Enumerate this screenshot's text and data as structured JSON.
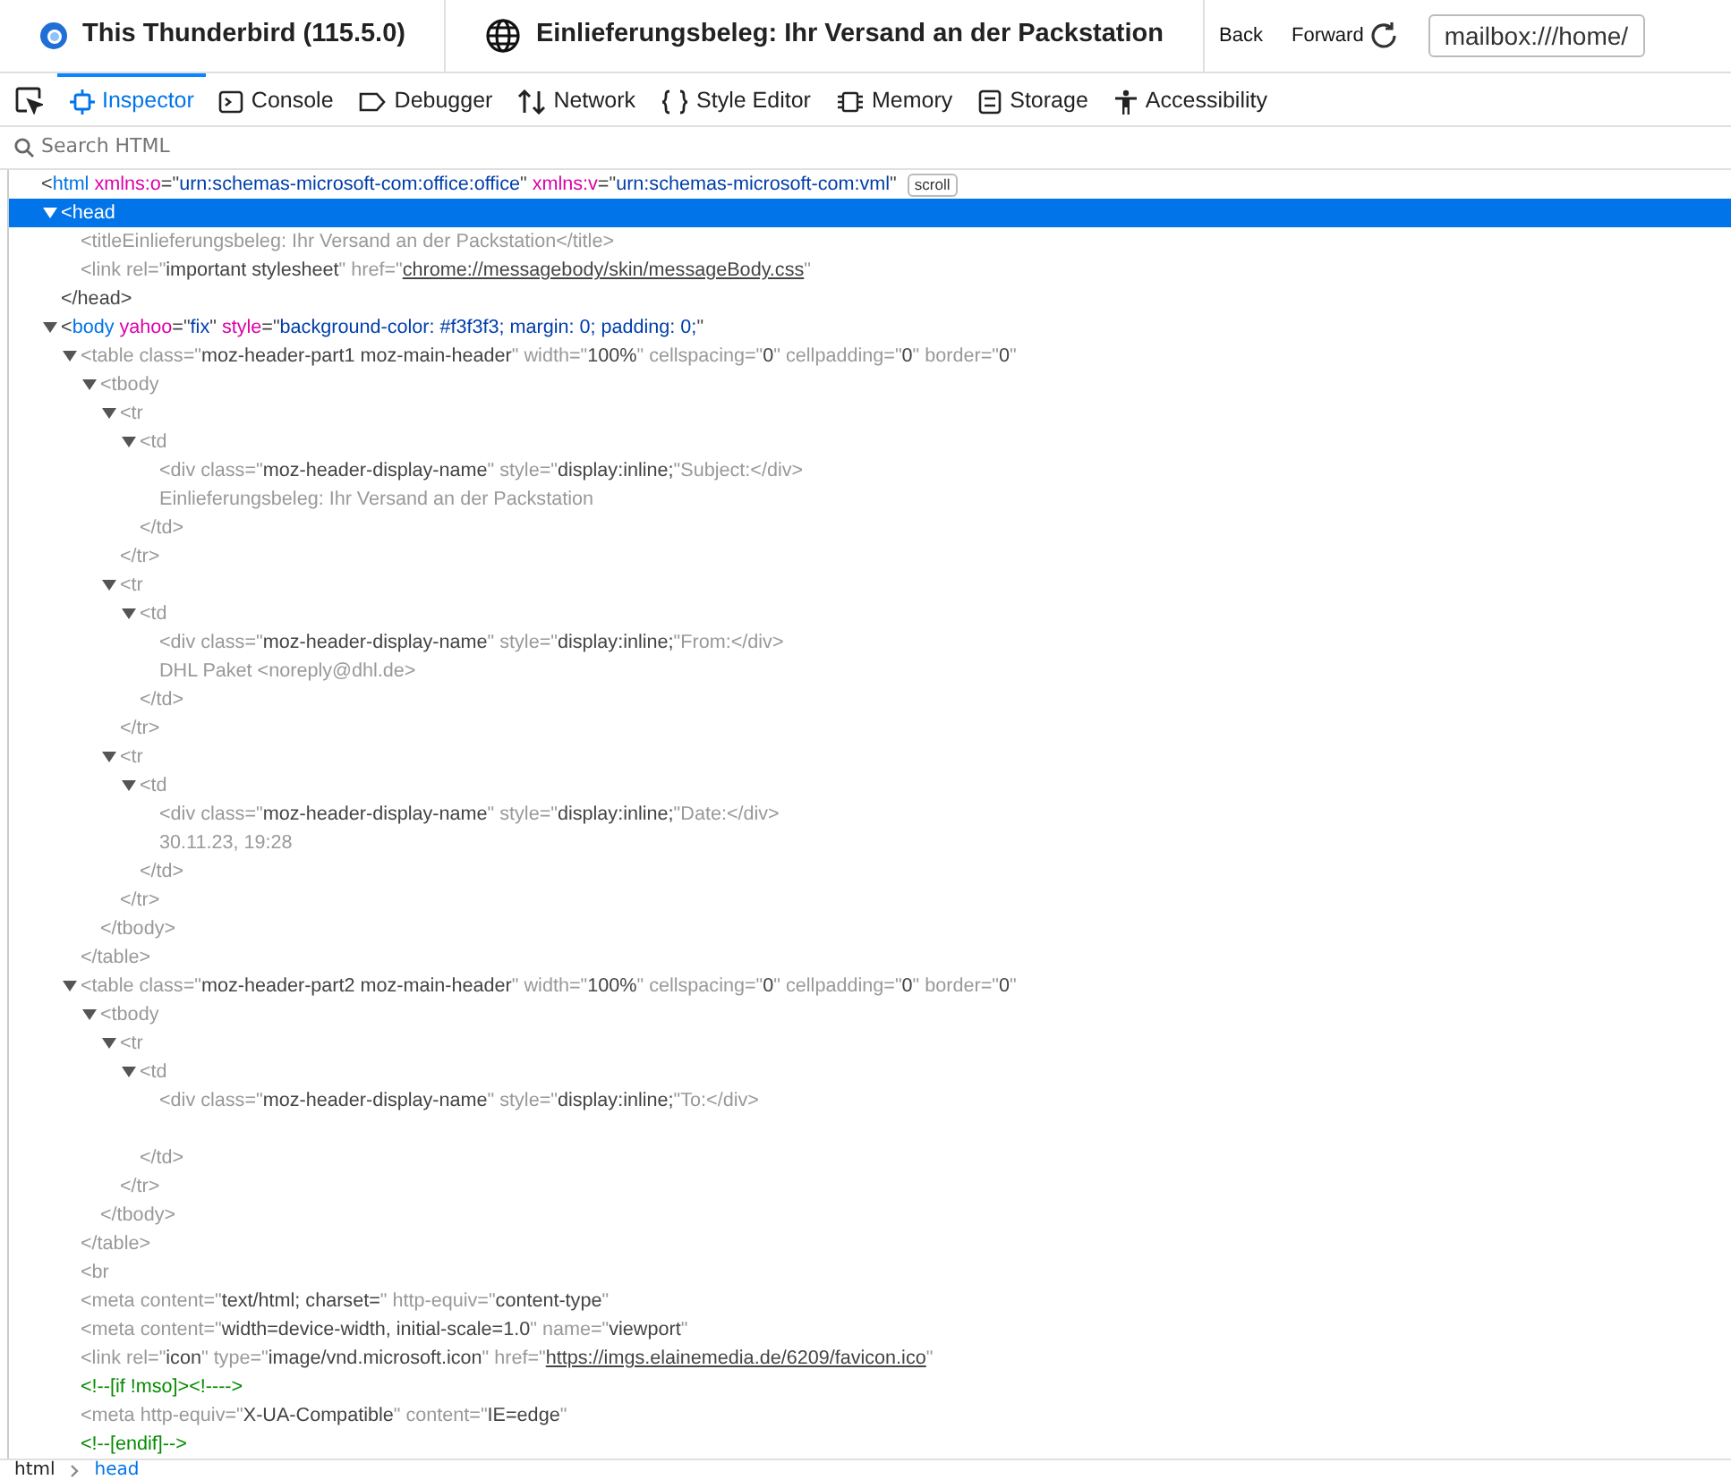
{
  "browser_tabs": [
    {
      "title": "This Thunderbird (115.5.0)"
    },
    {
      "title": "Einlieferungsbeleg: Ihr Versand an der Packstation"
    }
  ],
  "nav": {
    "back": "Back",
    "forward": "Forward",
    "url": "mailbox:///home/"
  },
  "devtools_tabs": [
    {
      "label": "Inspector",
      "selected": true
    },
    {
      "label": "Console",
      "selected": false
    },
    {
      "label": "Debugger",
      "selected": false
    },
    {
      "label": "Network",
      "selected": false
    },
    {
      "label": "Style Editor",
      "selected": false
    },
    {
      "label": "Memory",
      "selected": false
    },
    {
      "label": "Storage",
      "selected": false
    },
    {
      "label": "Accessibility",
      "selected": false
    }
  ],
  "search": {
    "placeholder": "Search HTML"
  },
  "markup": [
    {
      "dimmed": false,
      "selected": false,
      "badge": "scroll",
      "open": [
        {
          "kind": "p",
          "text": "<"
        },
        {
          "kind": "tag",
          "text": "html"
        },
        {
          "kind": "attr",
          "text": " xmlns:o"
        },
        {
          "kind": "p",
          "text": "=\""
        },
        {
          "kind": "value",
          "text": "urn:schemas-microsoft-com:office:office"
        },
        {
          "kind": "p",
          "text": "\" "
        },
        {
          "kind": "attr",
          "text": "xmlns:v"
        },
        {
          "kind": "p",
          "text": "=\""
        },
        {
          "kind": "value",
          "text": "urn:schemas-microsoft-com:vml"
        },
        {
          "kind": "p",
          "text": "\""
        }
      ],
      "children": [
        {
          "dimmed": false,
          "selected": true,
          "expanded": true,
          "open": [
            {
              "kind": "p",
              "text": "<"
            },
            {
              "kind": "tag",
              "text": "head"
            }
          ],
          "close": [
            {
              "kind": "p",
              "text": "</head>"
            }
          ],
          "children": [
            {
              "dimmed": true,
              "selected": false,
              "open": [
                {
                  "kind": "p",
                  "text": "<title"
                },
                {
                  "kind": "text",
                  "text": "Einlieferungsbeleg: Ihr Versand an der Packstation"
                },
                {
                  "kind": "p",
                  "text": "</title>"
                }
              ]
            },
            {
              "dimmed": true,
              "selected": false,
              "open": [
                {
                  "kind": "p",
                  "text": "<link "
                },
                {
                  "kind": "attr",
                  "text": "rel"
                },
                {
                  "kind": "p",
                  "text": "=\""
                },
                {
                  "kind": "value",
                  "text": "important stylesheet"
                },
                {
                  "kind": "p",
                  "text": "\" "
                },
                {
                  "kind": "attr",
                  "text": "href"
                },
                {
                  "kind": "p",
                  "text": "=\""
                },
                {
                  "kind": "link",
                  "text": "chrome://messagebody/skin/messageBody.css"
                },
                {
                  "kind": "p",
                  "text": "\""
                }
              ]
            }
          ]
        },
        {
          "dimmed": false,
          "selected": false,
          "expanded": true,
          "open": [
            {
              "kind": "p",
              "text": "<"
            },
            {
              "kind": "tag",
              "text": "body"
            },
            {
              "kind": "attr",
              "text": " yahoo"
            },
            {
              "kind": "p",
              "text": "=\""
            },
            {
              "kind": "value",
              "text": "fix"
            },
            {
              "kind": "p",
              "text": "\" "
            },
            {
              "kind": "attr",
              "text": "style"
            },
            {
              "kind": "p",
              "text": "=\""
            },
            {
              "kind": "value",
              "text": "background-color: #f3f3f3; margin: 0; padding: 0;"
            },
            {
              "kind": "p",
              "text": "\""
            }
          ],
          "children": [
            {
              "dimmed": true,
              "selected": false,
              "expanded": true,
              "open": [
                {
                  "kind": "p",
                  "text": "<table "
                },
                {
                  "kind": "attr",
                  "text": "class"
                },
                {
                  "kind": "p",
                  "text": "=\""
                },
                {
                  "kind": "value",
                  "text": "moz-header-part1 moz-main-header"
                },
                {
                  "kind": "p",
                  "text": "\" "
                },
                {
                  "kind": "attr",
                  "text": "width"
                },
                {
                  "kind": "p",
                  "text": "=\""
                },
                {
                  "kind": "value",
                  "text": "100%"
                },
                {
                  "kind": "p",
                  "text": "\" "
                },
                {
                  "kind": "attr",
                  "text": "cellspacing"
                },
                {
                  "kind": "p",
                  "text": "=\""
                },
                {
                  "kind": "value",
                  "text": "0"
                },
                {
                  "kind": "p",
                  "text": "\" "
                },
                {
                  "kind": "attr",
                  "text": "cellpadding"
                },
                {
                  "kind": "p",
                  "text": "=\""
                },
                {
                  "kind": "value",
                  "text": "0"
                },
                {
                  "kind": "p",
                  "text": "\" "
                },
                {
                  "kind": "attr",
                  "text": "border"
                },
                {
                  "kind": "p",
                  "text": "=\""
                },
                {
                  "kind": "value",
                  "text": "0"
                },
                {
                  "kind": "p",
                  "text": "\""
                }
              ],
              "close": [
                {
                  "kind": "p",
                  "text": "</table>"
                }
              ],
              "children": [
                {
                  "dimmed": true,
                  "selected": false,
                  "expanded": true,
                  "open": [
                    {
                      "kind": "p",
                      "text": "<tbody"
                    }
                  ],
                  "close": [
                    {
                      "kind": "p",
                      "text": "</tbody>"
                    }
                  ],
                  "children": [
                    {
                      "dimmed": true,
                      "selected": false,
                      "expanded": true,
                      "open": [
                        {
                          "kind": "p",
                          "text": "<tr"
                        }
                      ],
                      "close": [
                        {
                          "kind": "p",
                          "text": "</tr>"
                        }
                      ],
                      "children": [
                        {
                          "dimmed": true,
                          "selected": false,
                          "expanded": true,
                          "open": [
                            {
                              "kind": "p",
                              "text": "<td"
                            }
                          ],
                          "close": [
                            {
                              "kind": "p",
                              "text": "</td>"
                            }
                          ],
                          "children": [
                            {
                              "dimmed": true,
                              "selected": false,
                              "open": [
                                {
                                  "kind": "p",
                                  "text": "<div "
                                },
                                {
                                  "kind": "attr",
                                  "text": "class"
                                },
                                {
                                  "kind": "p",
                                  "text": "=\""
                                },
                                {
                                  "kind": "value",
                                  "text": "moz-header-display-name"
                                },
                                {
                                  "kind": "p",
                                  "text": "\" "
                                },
                                {
                                  "kind": "attr",
                                  "text": "style"
                                },
                                {
                                  "kind": "p",
                                  "text": "=\""
                                },
                                {
                                  "kind": "value",
                                  "text": "display:inline;"
                                },
                                {
                                  "kind": "p",
                                  "text": "\""
                                },
                                {
                                  "kind": "text",
                                  "text": "Subject:"
                                },
                                {
                                  "kind": "p",
                                  "text": "</div>"
                                }
                              ]
                            },
                            {
                              "dimmed": true,
                              "selected": false,
                              "open": [
                                {
                                  "kind": "text",
                                  "text": "Einlieferungsbeleg: Ihr Versand an der Packstation"
                                }
                              ]
                            }
                          ]
                        }
                      ]
                    },
                    {
                      "dimmed": true,
                      "selected": false,
                      "expanded": true,
                      "open": [
                        {
                          "kind": "p",
                          "text": "<tr"
                        }
                      ],
                      "close": [
                        {
                          "kind": "p",
                          "text": "</tr>"
                        }
                      ],
                      "children": [
                        {
                          "dimmed": true,
                          "selected": false,
                          "expanded": true,
                          "open": [
                            {
                              "kind": "p",
                              "text": "<td"
                            }
                          ],
                          "close": [
                            {
                              "kind": "p",
                              "text": "</td>"
                            }
                          ],
                          "children": [
                            {
                              "dimmed": true,
                              "selected": false,
                              "open": [
                                {
                                  "kind": "p",
                                  "text": "<div "
                                },
                                {
                                  "kind": "attr",
                                  "text": "class"
                                },
                                {
                                  "kind": "p",
                                  "text": "=\""
                                },
                                {
                                  "kind": "value",
                                  "text": "moz-header-display-name"
                                },
                                {
                                  "kind": "p",
                                  "text": "\" "
                                },
                                {
                                  "kind": "attr",
                                  "text": "style"
                                },
                                {
                                  "kind": "p",
                                  "text": "=\""
                                },
                                {
                                  "kind": "value",
                                  "text": "display:inline;"
                                },
                                {
                                  "kind": "p",
                                  "text": "\""
                                },
                                {
                                  "kind": "text",
                                  "text": "From:"
                                },
                                {
                                  "kind": "p",
                                  "text": "</div>"
                                }
                              ]
                            },
                            {
                              "dimmed": true,
                              "selected": false,
                              "open": [
                                {
                                  "kind": "text",
                                  "text": "DHL Paket <noreply@dhl.de>"
                                }
                              ]
                            }
                          ]
                        }
                      ]
                    },
                    {
                      "dimmed": true,
                      "selected": false,
                      "expanded": true,
                      "open": [
                        {
                          "kind": "p",
                          "text": "<tr"
                        }
                      ],
                      "close": [
                        {
                          "kind": "p",
                          "text": "</tr>"
                        }
                      ],
                      "children": [
                        {
                          "dimmed": true,
                          "selected": false,
                          "expanded": true,
                          "open": [
                            {
                              "kind": "p",
                              "text": "<td"
                            }
                          ],
                          "close": [
                            {
                              "kind": "p",
                              "text": "</td>"
                            }
                          ],
                          "children": [
                            {
                              "dimmed": true,
                              "selected": false,
                              "open": [
                                {
                                  "kind": "p",
                                  "text": "<div "
                                },
                                {
                                  "kind": "attr",
                                  "text": "class"
                                },
                                {
                                  "kind": "p",
                                  "text": "=\""
                                },
                                {
                                  "kind": "value",
                                  "text": "moz-header-display-name"
                                },
                                {
                                  "kind": "p",
                                  "text": "\" "
                                },
                                {
                                  "kind": "attr",
                                  "text": "style"
                                },
                                {
                                  "kind": "p",
                                  "text": "=\""
                                },
                                {
                                  "kind": "value",
                                  "text": "display:inline;"
                                },
                                {
                                  "kind": "p",
                                  "text": "\""
                                },
                                {
                                  "kind": "text",
                                  "text": "Date:"
                                },
                                {
                                  "kind": "p",
                                  "text": "</div>"
                                }
                              ]
                            },
                            {
                              "dimmed": true,
                              "selected": false,
                              "open": [
                                {
                                  "kind": "text",
                                  "text": "30.11.23, 19:28"
                                }
                              ]
                            }
                          ]
                        }
                      ]
                    }
                  ]
                }
              ]
            },
            {
              "dimmed": true,
              "selected": false,
              "expanded": true,
              "open": [
                {
                  "kind": "p",
                  "text": "<table "
                },
                {
                  "kind": "attr",
                  "text": "class"
                },
                {
                  "kind": "p",
                  "text": "=\""
                },
                {
                  "kind": "value",
                  "text": "moz-header-part2 moz-main-header"
                },
                {
                  "kind": "p",
                  "text": "\" "
                },
                {
                  "kind": "attr",
                  "text": "width"
                },
                {
                  "kind": "p",
                  "text": "=\""
                },
                {
                  "kind": "value",
                  "text": "100%"
                },
                {
                  "kind": "p",
                  "text": "\" "
                },
                {
                  "kind": "attr",
                  "text": "cellspacing"
                },
                {
                  "kind": "p",
                  "text": "=\""
                },
                {
                  "kind": "value",
                  "text": "0"
                },
                {
                  "kind": "p",
                  "text": "\" "
                },
                {
                  "kind": "attr",
                  "text": "cellpadding"
                },
                {
                  "kind": "p",
                  "text": "=\""
                },
                {
                  "kind": "value",
                  "text": "0"
                },
                {
                  "kind": "p",
                  "text": "\" "
                },
                {
                  "kind": "attr",
                  "text": "border"
                },
                {
                  "kind": "p",
                  "text": "=\""
                },
                {
                  "kind": "value",
                  "text": "0"
                },
                {
                  "kind": "p",
                  "text": "\""
                }
              ],
              "close": [
                {
                  "kind": "p",
                  "text": "</table>"
                }
              ],
              "children": [
                {
                  "dimmed": true,
                  "selected": false,
                  "expanded": true,
                  "open": [
                    {
                      "kind": "p",
                      "text": "<tbody"
                    }
                  ],
                  "close": [
                    {
                      "kind": "p",
                      "text": "</tbody>"
                    }
                  ],
                  "children": [
                    {
                      "dimmed": true,
                      "selected": false,
                      "expanded": true,
                      "open": [
                        {
                          "kind": "p",
                          "text": "<tr"
                        }
                      ],
                      "close": [
                        {
                          "kind": "p",
                          "text": "</tr>"
                        }
                      ],
                      "children": [
                        {
                          "dimmed": true,
                          "selected": false,
                          "expanded": true,
                          "open": [
                            {
                              "kind": "p",
                              "text": "<td"
                            }
                          ],
                          "close": [
                            {
                              "kind": "p",
                              "text": "</td>"
                            }
                          ],
                          "gap_after_children": true,
                          "children": [
                            {
                              "dimmed": true,
                              "selected": false,
                              "open": [
                                {
                                  "kind": "p",
                                  "text": "<div "
                                },
                                {
                                  "kind": "attr",
                                  "text": "class"
                                },
                                {
                                  "kind": "p",
                                  "text": "=\""
                                },
                                {
                                  "kind": "value",
                                  "text": "moz-header-display-name"
                                },
                                {
                                  "kind": "p",
                                  "text": "\" "
                                },
                                {
                                  "kind": "attr",
                                  "text": "style"
                                },
                                {
                                  "kind": "p",
                                  "text": "=\""
                                },
                                {
                                  "kind": "value",
                                  "text": "display:inline;"
                                },
                                {
                                  "kind": "p",
                                  "text": "\""
                                },
                                {
                                  "kind": "text",
                                  "text": "To:"
                                },
                                {
                                  "kind": "p",
                                  "text": "</div>"
                                }
                              ]
                            }
                          ]
                        }
                      ]
                    }
                  ]
                }
              ]
            },
            {
              "dimmed": true,
              "selected": false,
              "open": [
                {
                  "kind": "p",
                  "text": "<br"
                }
              ]
            },
            {
              "dimmed": true,
              "selected": false,
              "open": [
                {
                  "kind": "p",
                  "text": "<meta "
                },
                {
                  "kind": "attr",
                  "text": "content"
                },
                {
                  "kind": "p",
                  "text": "=\""
                },
                {
                  "kind": "value",
                  "text": "text/html; charset="
                },
                {
                  "kind": "p",
                  "text": "\" "
                },
                {
                  "kind": "attr",
                  "text": "http-equiv"
                },
                {
                  "kind": "p",
                  "text": "=\""
                },
                {
                  "kind": "value",
                  "text": "content-type"
                },
                {
                  "kind": "p",
                  "text": "\""
                }
              ]
            },
            {
              "dimmed": true,
              "selected": false,
              "open": [
                {
                  "kind": "p",
                  "text": "<meta "
                },
                {
                  "kind": "attr",
                  "text": "content"
                },
                {
                  "kind": "p",
                  "text": "=\""
                },
                {
                  "kind": "value",
                  "text": "width=device-width, initial-scale=1.0"
                },
                {
                  "kind": "p",
                  "text": "\" "
                },
                {
                  "kind": "attr",
                  "text": "name"
                },
                {
                  "kind": "p",
                  "text": "=\""
                },
                {
                  "kind": "value",
                  "text": "viewport"
                },
                {
                  "kind": "p",
                  "text": "\""
                }
              ]
            },
            {
              "dimmed": true,
              "selected": false,
              "open": [
                {
                  "kind": "p",
                  "text": "<link "
                },
                {
                  "kind": "attr",
                  "text": "rel"
                },
                {
                  "kind": "p",
                  "text": "=\""
                },
                {
                  "kind": "value",
                  "text": "icon"
                },
                {
                  "kind": "p",
                  "text": "\" "
                },
                {
                  "kind": "attr",
                  "text": "type"
                },
                {
                  "kind": "p",
                  "text": "=\""
                },
                {
                  "kind": "value",
                  "text": "image/vnd.microsoft.icon"
                },
                {
                  "kind": "p",
                  "text": "\" "
                },
                {
                  "kind": "attr",
                  "text": "href"
                },
                {
                  "kind": "p",
                  "text": "=\""
                },
                {
                  "kind": "link",
                  "text": "https://imgs.elainemedia.de/6209/favicon.ico"
                },
                {
                  "kind": "p",
                  "text": "\""
                }
              ]
            },
            {
              "dimmed": true,
              "selected": false,
              "open": [
                {
                  "kind": "comment",
                  "text": "<!--[if !mso]><!---->"
                }
              ]
            },
            {
              "dimmed": true,
              "selected": false,
              "open": [
                {
                  "kind": "p",
                  "text": "<meta "
                },
                {
                  "kind": "attr",
                  "text": "http-equiv"
                },
                {
                  "kind": "p",
                  "text": "=\""
                },
                {
                  "kind": "value",
                  "text": "X-UA-Compatible"
                },
                {
                  "kind": "p",
                  "text": "\" "
                },
                {
                  "kind": "attr",
                  "text": "content"
                },
                {
                  "kind": "p",
                  "text": "=\""
                },
                {
                  "kind": "value",
                  "text": "IE=edge"
                },
                {
                  "kind": "p",
                  "text": "\""
                }
              ]
            },
            {
              "dimmed": true,
              "selected": false,
              "open": [
                {
                  "kind": "comment",
                  "text": "<!--[endif]-->"
                }
              ]
            }
          ]
        }
      ]
    }
  ],
  "breadcrumbs": [
    {
      "label": "html",
      "selected": false
    },
    {
      "label": "head",
      "selected": true
    }
  ]
}
